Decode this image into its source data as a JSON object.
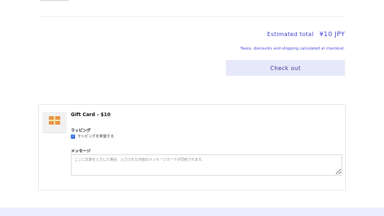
{
  "cart": {
    "estimated_total_label": "Estimated total",
    "estimated_total_value": "¥10 JPY",
    "tax_note": "Taxes, discounts and shipping calculated at checkout.",
    "checkout_label": "Check out"
  },
  "product": {
    "title": "Gift Card - $10",
    "image_icon": "gift-box-icon"
  },
  "wrapping": {
    "label": "ラッピング",
    "checkbox_label": "ラッピングを希望する",
    "checked": true
  },
  "message": {
    "label": "メッセージ",
    "placeholder": "ここに文章を入力した場合、入力された内容のメッセージカードが同封されます。"
  },
  "colors": {
    "accent": "#3b3bd6",
    "button_bg": "#e8e8fb",
    "footer_band": "#ececff"
  }
}
